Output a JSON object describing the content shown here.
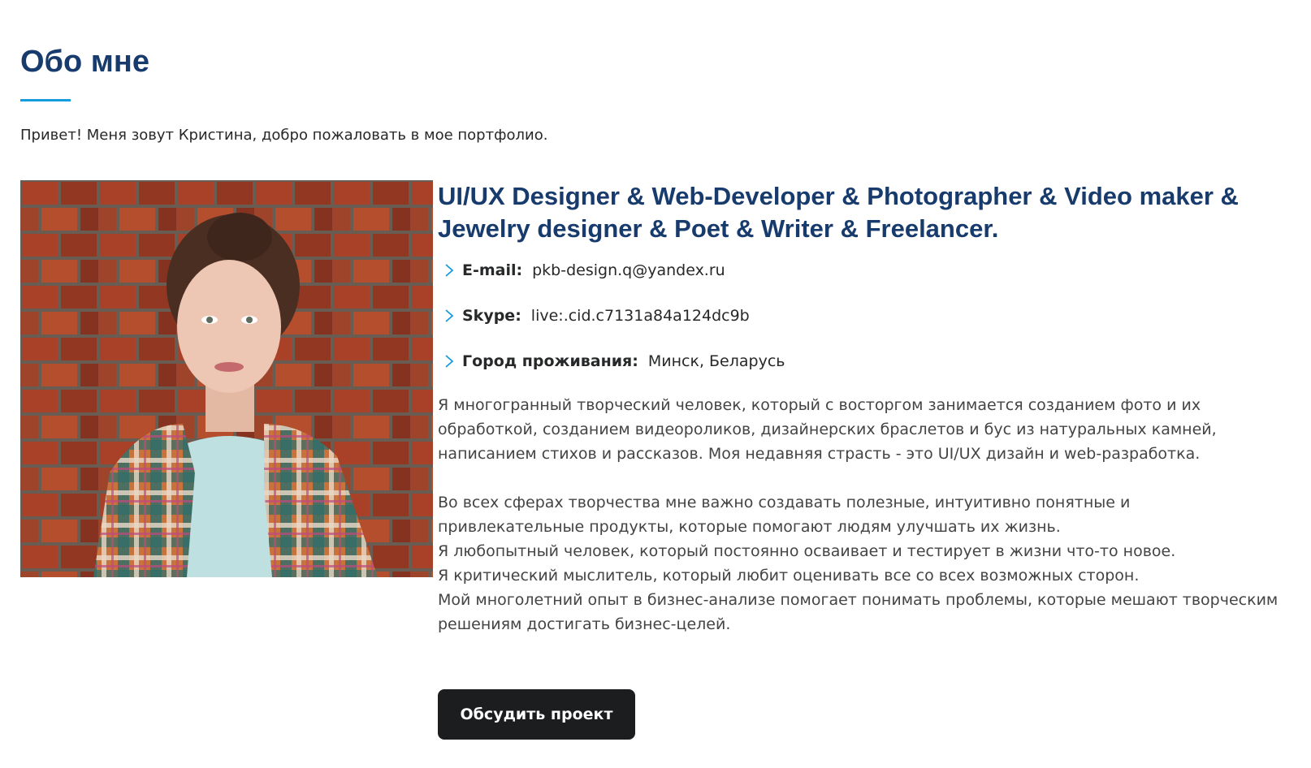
{
  "about": {
    "title": "Обо мне",
    "intro": "Привет! Меня зовут Кристина, добро пожаловать в мое портфолио.",
    "role": "UI/UX Designer & Web-Developer & Photographer & Video maker & Jewelry designer & Poet & Writer & Freelancer.",
    "info": [
      {
        "label": "E-mail:",
        "value": "pkb-design.q@yandex.ru",
        "icon": "chevron-right-icon"
      },
      {
        "label": "Skype:",
        "value": "live:.cid.c7131a84a124dc9b",
        "icon": "chevron-right-icon"
      },
      {
        "label": "Город проживания:",
        "value": "Минск, Беларусь",
        "icon": "chevron-right-icon"
      }
    ],
    "bio": {
      "p1": "Я многогранный творческий человек, который с восторгом занимается созданием фото и их обработкой, созданием видеороликов, дизайнерских браслетов и бус из натуральных камней, написанием стихов и рассказов. Моя недавняя страсть - это UI/UX дизайн и web-разработка.",
      "p2": "Во всех сферах творчества мне важно создавать полезные, интуитивно понятные и привлекательные продукты, которые помогают людям улучшать их жизнь.",
      "p3": "Я любопытный человек, который постоянно осваивает и тестирует в жизни что-то новое.",
      "p4": "Я критический мыслитель, который любит оценивать все со всех возможных сторон.",
      "p5": "Мой многолетний опыт в бизнес-анализе помогает понимать проблемы, которые мешают творческим решениям достигать бизнес-целей."
    },
    "cta_label": "Обсудить проект"
  },
  "colors": {
    "heading": "#173b6c",
    "accent": "#149ddd",
    "button_bg": "#1b1d1f",
    "button_text": "#ffffff"
  }
}
